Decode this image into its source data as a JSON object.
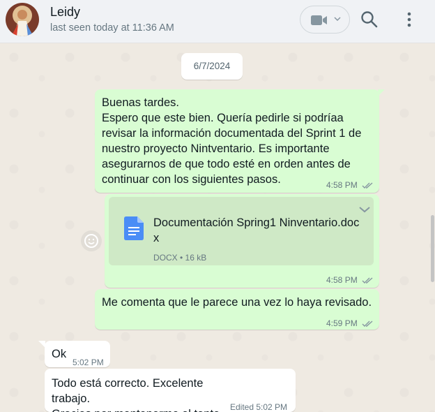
{
  "header": {
    "contact_name": "Leidy",
    "last_seen": "last seen today at 11:36 AM",
    "avatar_icon": "profile-picture",
    "video_icon": "video-camera-icon",
    "search_icon": "search-icon",
    "menu_icon": "kebab-menu-icon"
  },
  "chat": {
    "date_chip": "6/7/2024",
    "messages": [
      {
        "direction": "outgoing",
        "text": "Buenas tardes.\nEspero que este bien. Quería pedirle si podríaa revisar la información documentada del Sprint 1 de nuestro proyecto Nintventario. Es importante asegurarnos de que todo esté en orden antes de continuar con los siguientes pasos.",
        "time": "4:58 PM",
        "status": "read"
      },
      {
        "direction": "outgoing",
        "type": "document",
        "file_name": "Documentación Spring1 Ninventario.docx",
        "file_info": "DOCX • 16 kB",
        "time": "4:58 PM",
        "status": "read"
      },
      {
        "direction": "outgoing",
        "text": "Me comenta que le parece una vez lo haya revisado.",
        "time": "4:59 PM",
        "status": "read"
      },
      {
        "direction": "incoming",
        "text": "Ok",
        "time": "5:02 PM"
      },
      {
        "direction": "incoming",
        "text": "Todo está correcto. Excelente trabajo.\nGracias por mantenerme al tanto.",
        "time": "Edited 5:02 PM"
      }
    ]
  },
  "colors": {
    "outgoing_bubble": "#d9fdd3",
    "incoming_bubble": "#ffffff",
    "read_ticks": "#8696a0",
    "doc_icon": "#4a8df6"
  }
}
